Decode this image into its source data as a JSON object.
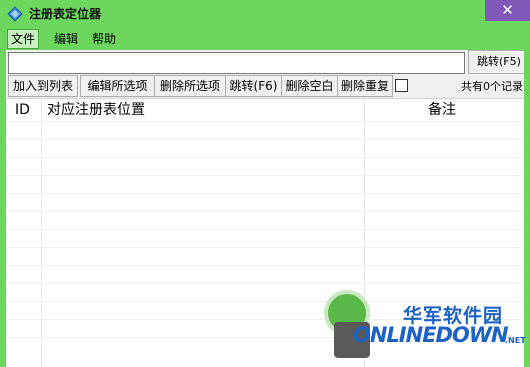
{
  "window": {
    "title": "注册表定位器",
    "close_glyph": "✕"
  },
  "menu": [
    "文件",
    "编辑",
    "帮助"
  ],
  "path_input": {
    "value": ""
  },
  "jump_top_label": "跳转(F5)",
  "toolbar": {
    "buttons": [
      "加入到列表",
      "编辑所选项",
      "删除所选项",
      "跳转(F6)",
      "删除空白",
      "删除重复"
    ],
    "count_text": "共有0个记录"
  },
  "list": {
    "columns": [
      "ID",
      "对应注册表位置",
      "备注"
    ]
  },
  "watermark": {
    "cn_text": "华军软件园",
    "en_text": "ONLINEDOWN",
    "suffix": ".NET"
  },
  "colors": {
    "titlebar": "#6dd65f",
    "close_button": "#7f58b8",
    "watermark_blue": "#1c62c4"
  }
}
